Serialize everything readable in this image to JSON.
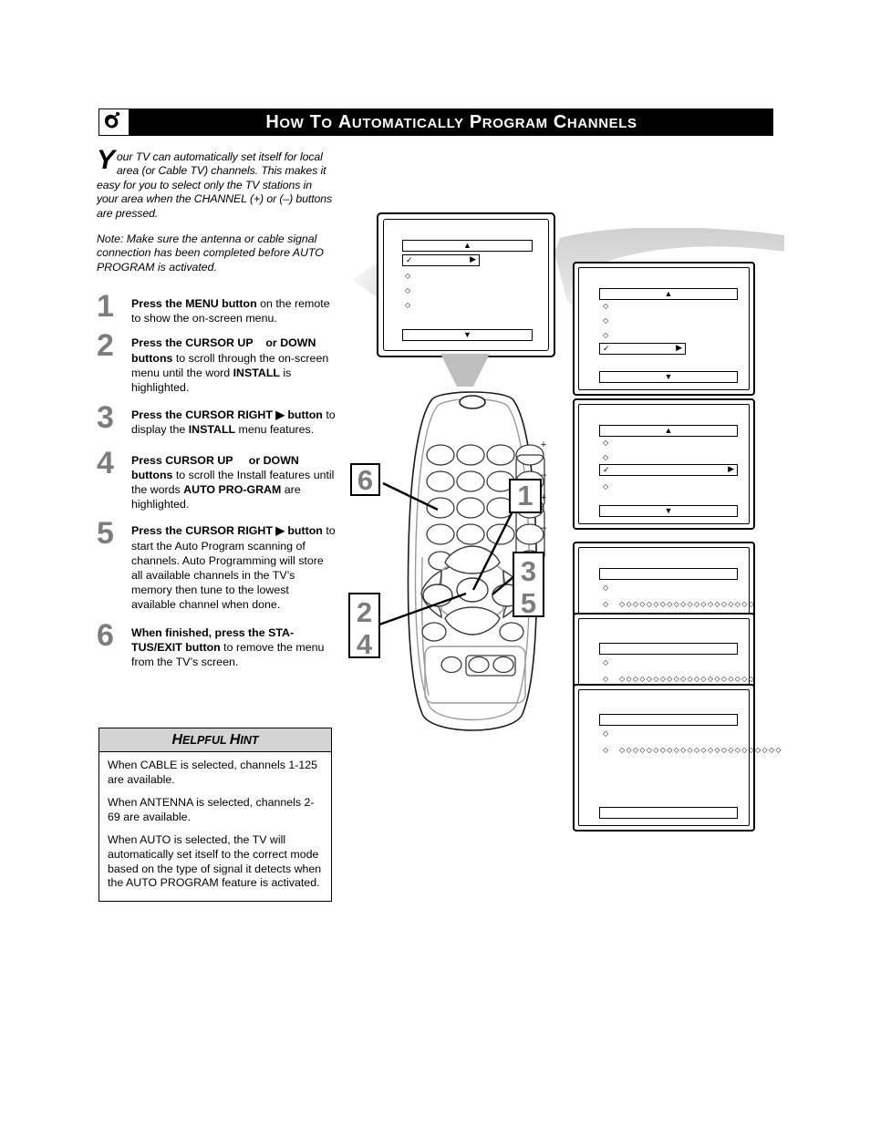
{
  "header": {
    "logo_icon": "philips-shield-icon",
    "title_words": [
      {
        "first": "H",
        "rest": "OW"
      },
      {
        "first": "T",
        "rest": "O"
      },
      {
        "first": "A",
        "rest": "UTOMATICALLY"
      },
      {
        "first": "P",
        "rest": "ROGRAM"
      },
      {
        "first": "C",
        "rest": "HANNELS"
      }
    ],
    "title_plain": "How to Automatically Program Channels"
  },
  "intro": {
    "dropcap": "Y",
    "paragraph": "our TV can automatically set itself for local area (or Cable TV) channels. This makes it easy for you to select only the TV stations in your area when the CHANNEL (+) or (–) buttons are pressed.",
    "note": "Note: Make sure the antenna or cable signal connection has been completed before AUTO PROGRAM is activated."
  },
  "steps": [
    {
      "number": "1",
      "parts": [
        {
          "t": "Press the MENU button",
          "b": true
        },
        {
          "t": " on the remote to show the on-screen menu.",
          "b": false
        }
      ]
    },
    {
      "number": "2",
      "parts": [
        {
          "t": "Press the CURSOR UP",
          "b": true
        },
        {
          "t": "    or DOWN",
          "b": true
        },
        {
          "t": "     buttons",
          "b": true
        },
        {
          "t": " to scroll through the on-screen menu until the word ",
          "b": false
        },
        {
          "t": "INSTALL",
          "b": true
        },
        {
          "t": " is highlighted.",
          "b": false
        }
      ]
    },
    {
      "number": "3",
      "parts": [
        {
          "t": "Press the CURSOR RIGHT ▶",
          "b": true
        },
        {
          "t": " button",
          "b": true
        },
        {
          "t": " to display the ",
          "b": false
        },
        {
          "t": "INSTALL",
          "b": true
        },
        {
          "t": " menu features.",
          "b": false
        }
      ]
    },
    {
      "number": "4",
      "parts": [
        {
          "t": "Press CURSOR UP",
          "b": true
        },
        {
          "t": "     or DOWN",
          "b": true
        },
        {
          "t": "     buttons",
          "b": true
        },
        {
          "t": " to scroll the Install features until the words ",
          "b": false
        },
        {
          "t": "AUTO PRO-GRAM",
          "b": true
        },
        {
          "t": " are highlighted.",
          "b": false
        }
      ]
    },
    {
      "number": "5",
      "parts": [
        {
          "t": "Press the CURSOR RIGHT ▶",
          "b": true
        },
        {
          "t": " button",
          "b": true
        },
        {
          "t": " to start the Auto Program scanning of channels. Auto Programming will store all available channels in the TV’s memory then tune to the lowest available channel when done.",
          "b": false
        }
      ]
    },
    {
      "number": "6",
      "parts": [
        {
          "t": "When finished, press the STA-TUS/EXIT button",
          "b": true
        },
        {
          "t": " to remove the menu from the TV’s screen.",
          "b": false
        }
      ]
    }
  ],
  "hint": {
    "title_first": "H",
    "title_rest": "ELPFUL ",
    "title_first2": "H",
    "title_rest2": "INT",
    "title_plain": "Helpful Hint",
    "paragraphs": [
      "When CABLE is selected, channels 1-125 are available.",
      "When ANTENNA is selected, channels 2-69 are available.",
      "When AUTO is selected, the TV will automatically set itself to the correct mode based on the type of signal it detects when the AUTO PROGRAM feature is activated."
    ]
  },
  "diagram": {
    "tv_label": "tv-with-on-screen-menu",
    "remote_label": "remote-control-illustration",
    "glyphs": {
      "up_arrow": "▲",
      "down_arrow": "▼",
      "right_arrow": "▶",
      "check": "✓",
      "diamond": "◇",
      "plus": "+",
      "minus": "–"
    },
    "progress_fill": "◇◇◇◇◇◇◇◇◇◇◇◇◇◇◇◇◇◇◇◇◇◇◇◇",
    "callouts": [
      {
        "id": "callout-1",
        "label": "1"
      },
      {
        "id": "callout-2-4",
        "label": "2",
        "label2": "4"
      },
      {
        "id": "callout-3-5",
        "label": "3",
        "label2": "5"
      },
      {
        "id": "callout-6",
        "label": "6"
      }
    ],
    "screens": [
      {
        "name": "tv-screen-main-menu",
        "selected_index": 1,
        "rows": 5
      },
      {
        "name": "panel-install-menu",
        "selected_index": 3,
        "rows": 4
      },
      {
        "name": "panel-auto-program-highlighted",
        "selected_index": 2,
        "rows": 4
      },
      {
        "name": "panel-scanning-1",
        "rows": 2
      },
      {
        "name": "panel-scanning-2",
        "rows": 2
      },
      {
        "name": "panel-scanning-3",
        "rows": 2
      }
    ]
  },
  "colors": {
    "header_bg": "#000000",
    "header_text": "#ffffff",
    "step_number": "#7d7d7d",
    "hint_header_bg": "#d4d4d4",
    "diagram_gray": "#c9c9c9",
    "line": "#000000"
  }
}
